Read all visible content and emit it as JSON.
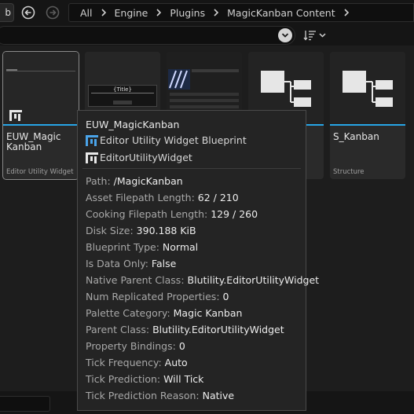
{
  "toolbar": {
    "left_tab_label": "b",
    "breadcrumbs": [
      "All",
      "Engine",
      "Plugins",
      "MagicKanban Content"
    ]
  },
  "search": {
    "placeholder": ""
  },
  "assets": [
    {
      "name": "EUW_Magic Kanban",
      "type": "Editor Utility Widget",
      "selected": true
    },
    {
      "name": "",
      "type": "",
      "thumb_text": "{Title}"
    },
    {
      "name": "",
      "type": ""
    },
    {
      "name": "",
      "type": ""
    },
    {
      "name": "S_Kanban",
      "type": "Structure"
    }
  ],
  "tooltip": {
    "title": "EUW_MagicKanban",
    "class_label": "Editor Utility Widget Blueprint",
    "subtype_label": "EditorUtilityWidget",
    "properties": [
      {
        "key": "Path: ",
        "value": "/MagicKanban"
      },
      {
        "key": "Asset Filepath Length: ",
        "value": "62 / 210"
      },
      {
        "key": "Cooking Filepath Length: ",
        "value": "129 / 260"
      },
      {
        "key": "Disk Size: ",
        "value": "390.188 KiB"
      },
      {
        "key": "Blueprint Type: ",
        "value": "Normal"
      },
      {
        "key": "Is Data Only: ",
        "value": "False"
      },
      {
        "key": "Native Parent Class: ",
        "value": "Blutility.EditorUtilityWidget"
      },
      {
        "key": "Num Replicated Properties: ",
        "value": "0"
      },
      {
        "key": "Palette Category: ",
        "value": "Magic Kanban"
      },
      {
        "key": "Parent Class: ",
        "value": "Blutility.EditorUtilityWidget"
      },
      {
        "key": "Property Bindings: ",
        "value": "0"
      },
      {
        "key": "Tick Frequency: ",
        "value": "Auto"
      },
      {
        "key": "Tick Prediction: ",
        "value": "Will Tick"
      },
      {
        "key": "Tick Prediction Reason: ",
        "value": "Native"
      }
    ]
  },
  "icons": {
    "back": "back-arrow-icon",
    "forward": "forward-arrow-icon",
    "dropdown": "chevron-down-icon",
    "sort": "sort-icon",
    "widget": "widget-blueprint-icon",
    "structure": "structure-icon"
  },
  "colors": {
    "accent": "#27a5e6",
    "background": "#1a1a1a",
    "tooltip_bg": "#242424"
  }
}
